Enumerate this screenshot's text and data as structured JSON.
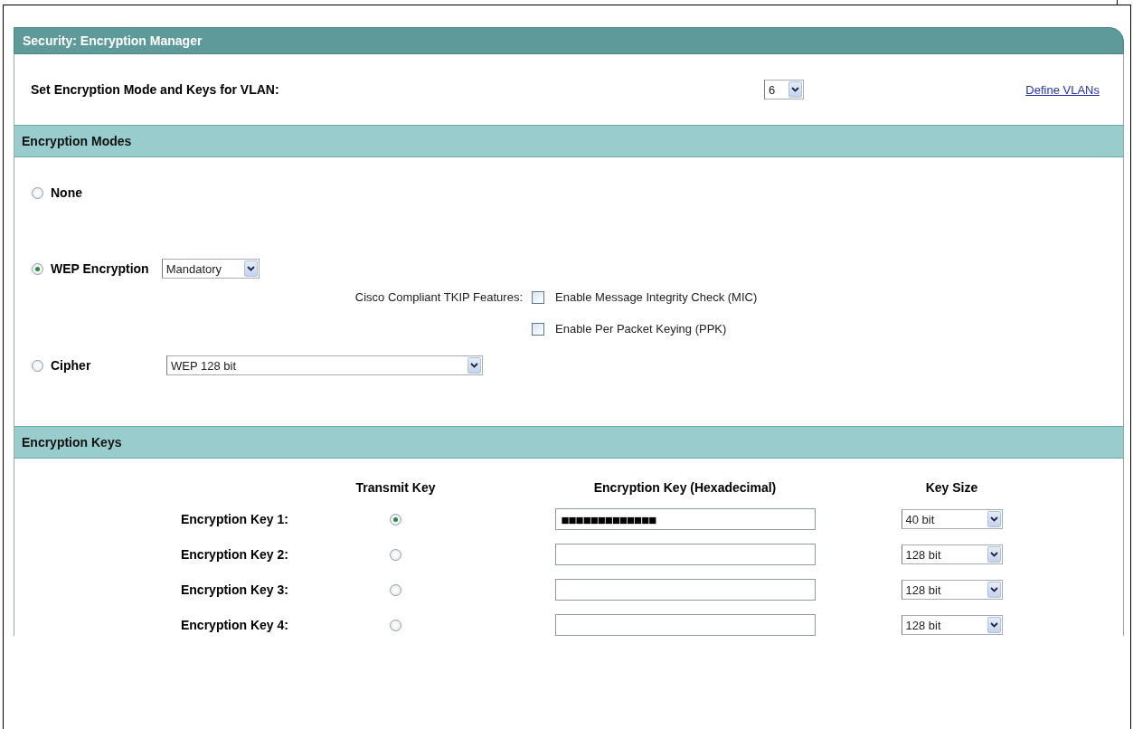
{
  "panel": {
    "title": "Security: Encryption Manager"
  },
  "vlan": {
    "label": "Set Encryption Mode and Keys for VLAN:",
    "value": "6",
    "link": "Define VLANs"
  },
  "modes_section": {
    "title": "Encryption Modes"
  },
  "modes": [
    {
      "kind": "plain",
      "label": "None",
      "selected": false
    },
    {
      "kind": "wep",
      "label": "WEP Encryption",
      "selected": true,
      "select_value": "Mandatory",
      "tkip_label": "Cisco Compliant TKIP Features:",
      "options": [
        {
          "label": "Enable Message Integrity Check (MIC)",
          "checked": false
        },
        {
          "label": "Enable Per Packet Keying (PPK)",
          "checked": false
        }
      ]
    },
    {
      "kind": "cipher",
      "label": "Cipher",
      "selected": false,
      "select_value": "WEP 128 bit"
    }
  ],
  "keys_section": {
    "title": "Encryption Keys"
  },
  "keys_columns": [
    "Transmit Key",
    "Encryption Key (Hexadecimal)",
    "Key Size"
  ],
  "keys": [
    {
      "label": "Encryption Key 1:",
      "selected": true,
      "value": "■■■■■■■■■■■■■",
      "size": "40 bit"
    },
    {
      "label": "Encryption Key 2:",
      "selected": false,
      "size": "128 bit"
    },
    {
      "label": "Encryption Key 3:",
      "selected": false,
      "size": "128 bit"
    },
    {
      "label": "Encryption Key 4:",
      "selected": false,
      "size": "128 bit"
    }
  ]
}
